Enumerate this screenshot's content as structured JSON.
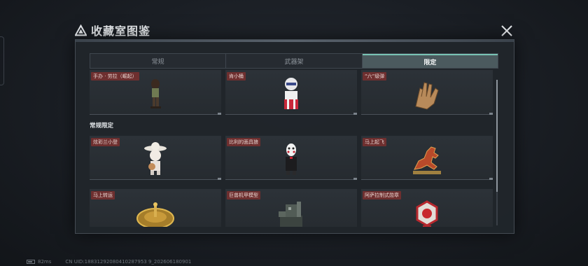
{
  "window": {
    "title": "收藏室图鉴",
    "close_icon": "close-icon"
  },
  "tabs": [
    {
      "label": "常规",
      "active": false
    },
    {
      "label": "武器架",
      "active": false
    },
    {
      "label": "限定",
      "active": true
    }
  ],
  "rows": {
    "top": [
      {
        "label": "手办 · 劳拉（崛起）",
        "icon": "lara-figure-icon"
      },
      {
        "label": "肯小桶",
        "icon": "bucket-mascot-icon"
      },
      {
        "label": "“六”级弹",
        "icon": "hand-gesture-icon"
      }
    ],
    "section_title": "常规限定",
    "middle": [
      {
        "label": "炫彩兰小登",
        "icon": "sombrero-character-icon"
      },
      {
        "label": "比利的面具狼",
        "icon": "puppet-mask-icon"
      },
      {
        "label": "马上起飞",
        "icon": "horse-statue-icon"
      }
    ],
    "bottom": [
      {
        "label": "马上转运",
        "icon": "golden-wheel-icon"
      },
      {
        "label": "巨兽机甲模型",
        "icon": "mech-model-icon"
      },
      {
        "label": "阿萨拉制式勋章",
        "icon": "medal-icon"
      }
    ]
  },
  "scroll": {
    "position": 0.0
  },
  "footer": {
    "battery_icon": "battery-icon",
    "ping": "82ms",
    "uid": "CN UID:18831292080410287953 9_202606180901"
  },
  "colors": {
    "label_bg": "#6e2f2f",
    "active_tab": "#4b5a5e",
    "accent": "#79c3b4"
  }
}
